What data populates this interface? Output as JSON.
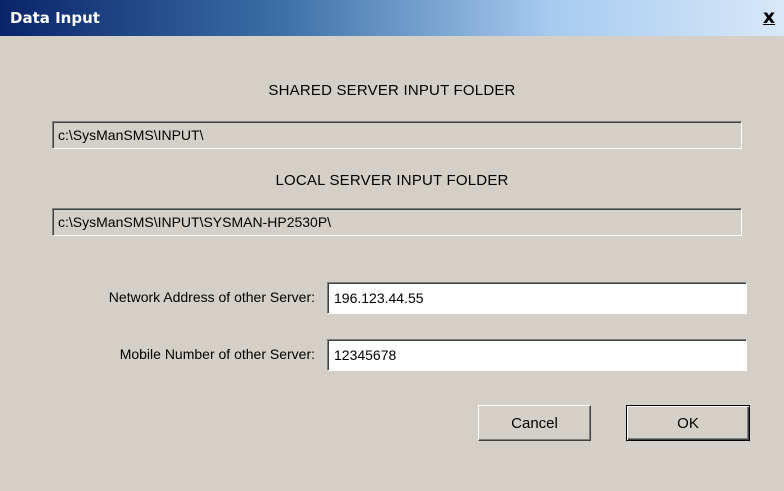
{
  "window": {
    "title": "Data Input",
    "close_glyph": "x"
  },
  "shared_folder": {
    "heading": "SHARED SERVER INPUT FOLDER",
    "path": "c:\\SysManSMS\\INPUT\\"
  },
  "local_folder": {
    "heading": "LOCAL SERVER INPUT FOLDER",
    "path": "c:\\SysManSMS\\INPUT\\SYSMAN-HP2530P\\"
  },
  "network_address": {
    "label": "Network Address of other Server:",
    "value": "196.123.44.55"
  },
  "mobile_number": {
    "label": "Mobile Number of other Server:",
    "value": "12345678"
  },
  "buttons": {
    "cancel_label": "Cancel",
    "ok_label": "OK"
  },
  "colors": {
    "dialog_background": "#d4d0c8",
    "titlebar_start": "#0a246a",
    "titlebar_end": "#d8e8f8"
  }
}
